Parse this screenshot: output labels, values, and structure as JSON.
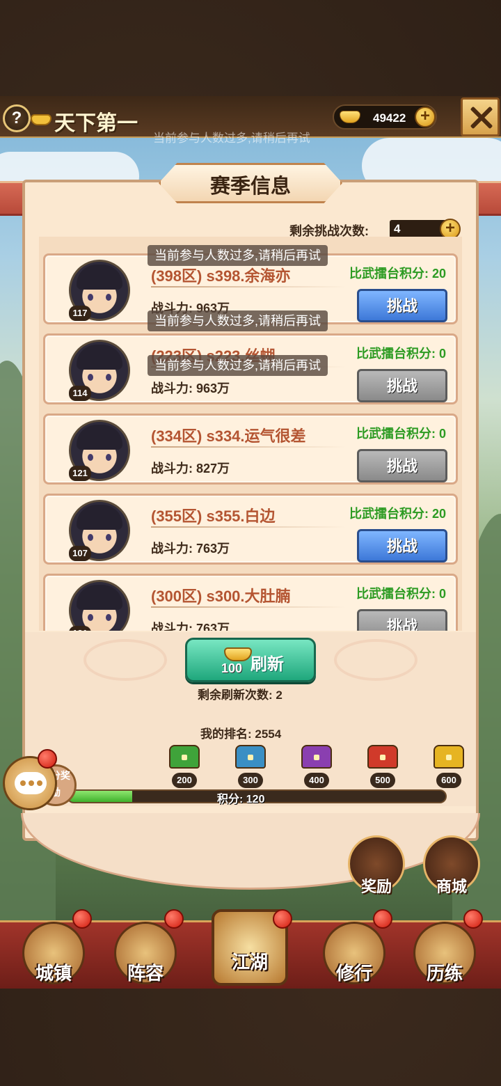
{
  "header": {
    "help_label": "?",
    "title": "天下第一",
    "gold": "49422",
    "plus": "+",
    "ghost_toast": "当前参与人数过多,请稍后再试"
  },
  "panel": {
    "title": "赛季信息",
    "remaining_label": "剩余挑战次数:",
    "remaining_value": "4"
  },
  "opponents": [
    {
      "name": "(398区) s398.余海亦",
      "power": "战斗力: 963万",
      "score": "比武擂台积分: 20",
      "level": "117",
      "button": "挑战",
      "button_state": "active"
    },
    {
      "name": "(223区) s223.丝蝴",
      "power": "战斗力: 963万",
      "score": "比武擂台积分: 0",
      "level": "114",
      "button": "挑战",
      "button_state": "disabled"
    },
    {
      "name": "(334区) s334.运气很差",
      "power": "战斗力: 827万",
      "score": "比武擂台积分: 0",
      "level": "121",
      "button": "挑战",
      "button_state": "disabled"
    },
    {
      "name": "(355区) s355.白边",
      "power": "战斗力: 763万",
      "score": "比武擂台积分: 20",
      "level": "107",
      "button": "挑战",
      "button_state": "active"
    },
    {
      "name": "(300区) s300.大肚腩",
      "power": "战斗力: 763万",
      "score": "比武擂台积分: 0",
      "level": "121",
      "button": "挑战",
      "button_state": "disabled"
    }
  ],
  "toasts": [
    "当前参与人数过多,请稍后再试",
    "当前参与人数过多,请稍后再试",
    "当前参与人数过多,请稍后再试"
  ],
  "refresh": {
    "cost": "100",
    "label": "刷新",
    "remaining": "剩余刷新次数: 2"
  },
  "ranking": {
    "my_rank": "我的排名: 2554",
    "reward_label": "积分奖励",
    "chests": [
      {
        "value": "200",
        "color": "#3fa33a"
      },
      {
        "value": "300",
        "color": "#3a8fc4"
      },
      {
        "value": "400",
        "color": "#8a3fb0"
      },
      {
        "value": "500",
        "color": "#d03a2a"
      },
      {
        "value": "600",
        "color": "#e6b422"
      }
    ],
    "score_text": "积分: 120",
    "progress": 0.17
  },
  "side_buttons": {
    "rewards": "奖励",
    "shop": "商城"
  },
  "nav": [
    "城镇",
    "阵容",
    "江湖",
    "修行",
    "历练"
  ]
}
